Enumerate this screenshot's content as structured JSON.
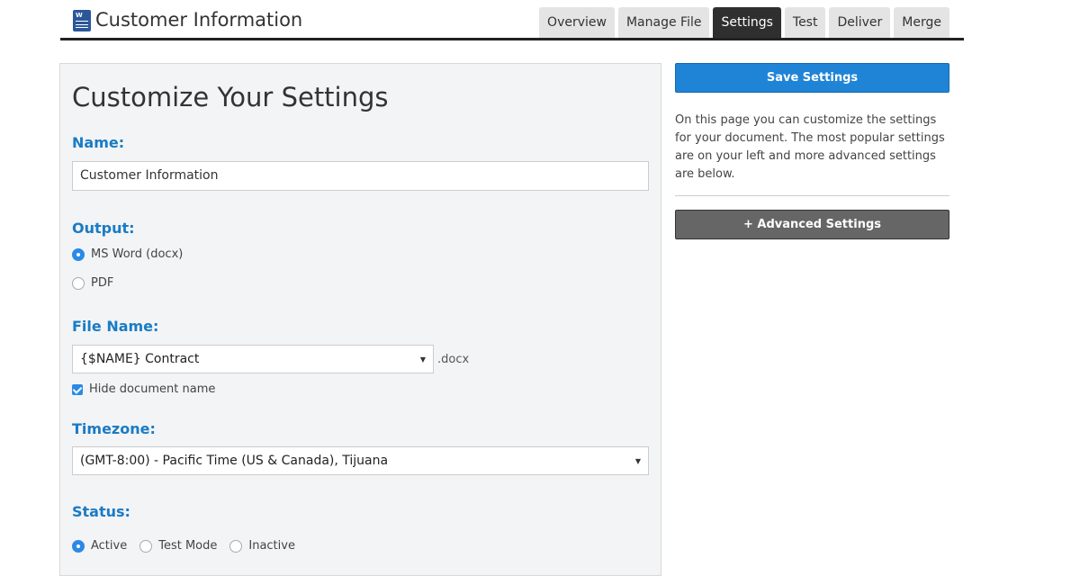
{
  "header": {
    "title": "Customer Information",
    "doc_icon_letter": "W",
    "tabs": [
      {
        "label": "Overview",
        "active": false
      },
      {
        "label": "Manage File",
        "active": false
      },
      {
        "label": "Settings",
        "active": true
      },
      {
        "label": "Test",
        "active": false
      },
      {
        "label": "Deliver",
        "active": false
      },
      {
        "label": "Merge",
        "active": false
      }
    ]
  },
  "settings": {
    "title": "Customize Your Settings",
    "name": {
      "label": "Name:",
      "value": "Customer Information"
    },
    "output": {
      "label": "Output:",
      "options": [
        {
          "label": "MS Word (docx)",
          "checked": true
        },
        {
          "label": "PDF",
          "checked": false
        }
      ]
    },
    "file_name": {
      "label": "File Name:",
      "selected": "{$NAME} Contract",
      "extension": ".docx",
      "hide_label": "Hide document name",
      "hide_checked": true
    },
    "timezone": {
      "label": "Timezone:",
      "selected": "(GMT-8:00) - Pacific Time (US & Canada), Tijuana"
    },
    "status": {
      "label": "Status:",
      "options": [
        {
          "label": "Active",
          "checked": true
        },
        {
          "label": "Test Mode",
          "checked": false
        },
        {
          "label": "Inactive",
          "checked": false
        }
      ]
    }
  },
  "sidebar": {
    "save_label": "Save Settings",
    "help_text": "On this page you can customize the settings for your document. The most popular settings are on your left and more advanced settings are below.",
    "advanced_label": "+ Advanced Settings"
  },
  "colors": {
    "accent": "#1f84d6",
    "label_blue": "#1a7bc4",
    "tab_active": "#2f2f2f",
    "advanced_button": "#666666"
  },
  "icons": {
    "doc_icon": "word-document-icon",
    "caret": "caret-down-icon"
  }
}
